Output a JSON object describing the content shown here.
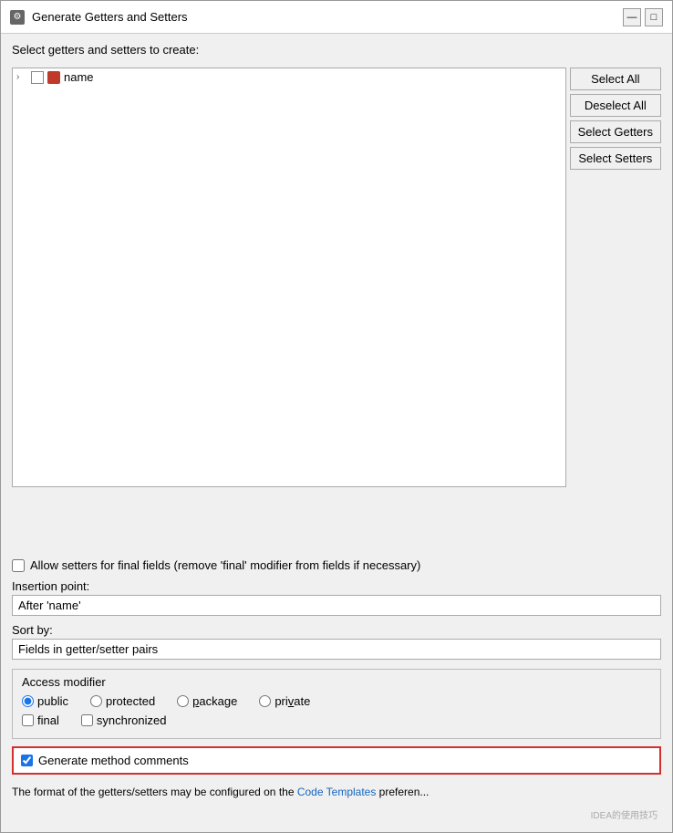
{
  "window": {
    "title": "Generate Getters and Setters",
    "icon": "gear"
  },
  "header": {
    "select_label": "Select getters and setters to create:"
  },
  "tree": {
    "items": [
      {
        "name": "name",
        "has_arrow": true,
        "checked": false,
        "field_color": "#c0392b"
      }
    ]
  },
  "buttons": {
    "select_all": "Select All",
    "deselect_all": "Deselect All",
    "select_getters": "Select Getters",
    "select_setters": "Select Setters"
  },
  "allow_setters": {
    "label": "Allow setters for final fields (remove 'final' modifier from fields if necessary)",
    "checked": false
  },
  "insertion_point": {
    "label": "Insertion point:",
    "value": "After 'name'"
  },
  "sort_by": {
    "label": "Sort by:",
    "value": "Fields in getter/setter pairs"
  },
  "access_modifier": {
    "title": "Access modifier",
    "options": [
      "public",
      "protected",
      "package",
      "private"
    ],
    "selected": "public",
    "checkboxes": [
      {
        "label": "final",
        "checked": false
      },
      {
        "label": "synchronized",
        "checked": false
      }
    ]
  },
  "generate_comments": {
    "label": "Generate method comments",
    "checked": true
  },
  "bottom_text": {
    "prefix": "The format of the getters/setters may be configured on the ",
    "link_text": "Code Templates",
    "suffix": " preferen..."
  }
}
